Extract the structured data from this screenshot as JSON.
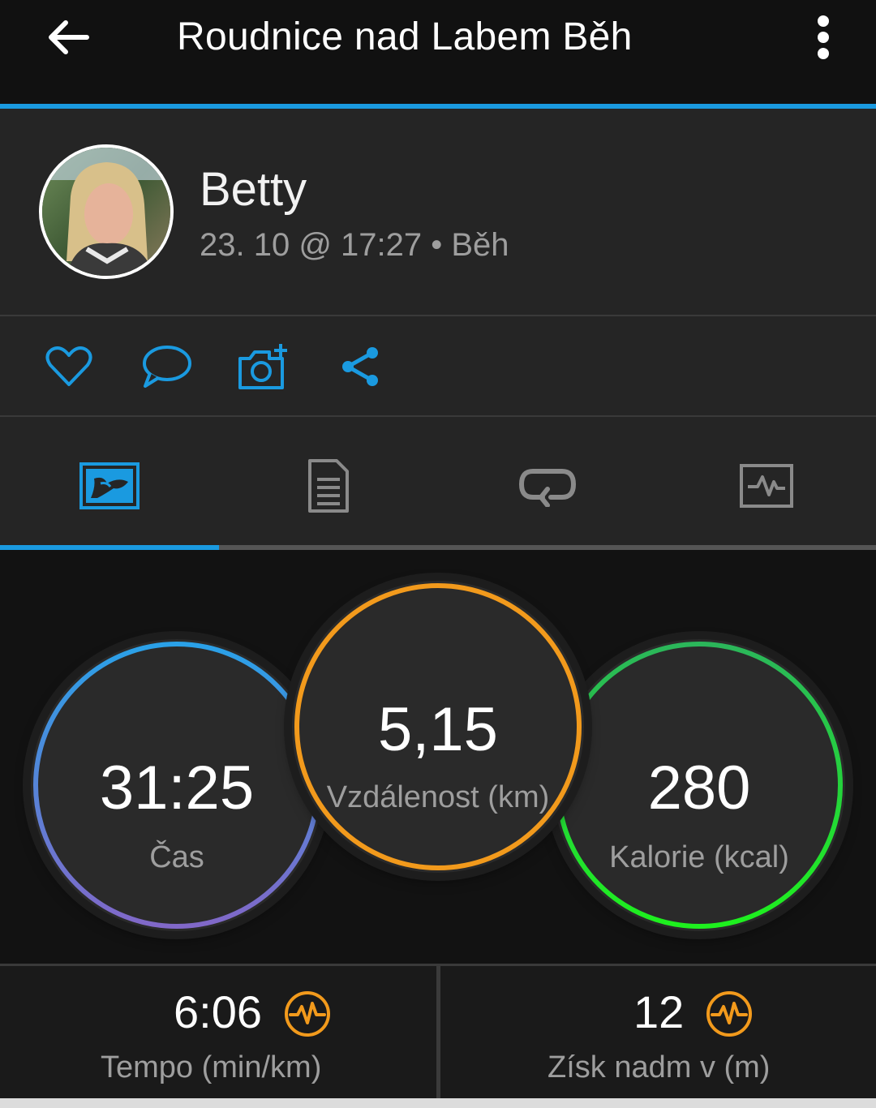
{
  "header": {
    "title": "Roudnice nad Labem Běh",
    "back_icon": "arrow-left-icon",
    "menu_icon": "more-vert-icon"
  },
  "profile": {
    "name": "Betty",
    "meta": "23. 10 @ 17:27 • Běh"
  },
  "actions": [
    "heart-icon",
    "comment-icon",
    "add-photo-icon",
    "share-icon"
  ],
  "tabs": [
    "map-tab-icon",
    "details-tab-icon",
    "laps-tab-icon",
    "charts-tab-icon"
  ],
  "stats": {
    "time": {
      "value": "31:25",
      "label": "Čas"
    },
    "distance": {
      "value": "5,15",
      "label": "Vzdálenost (km)"
    },
    "calories": {
      "value": "280",
      "label": "Kalorie (kcal)"
    }
  },
  "bottom": {
    "pace": {
      "value": "6:06",
      "label": "Tempo (min/km)"
    },
    "elevation": {
      "value": "12",
      "label": "Získ nadm v (m)"
    }
  },
  "colors": {
    "accent": "#1a9ae0",
    "orange": "#f29a1c",
    "green": "#22d43a",
    "purple": "#7f6fd0"
  }
}
